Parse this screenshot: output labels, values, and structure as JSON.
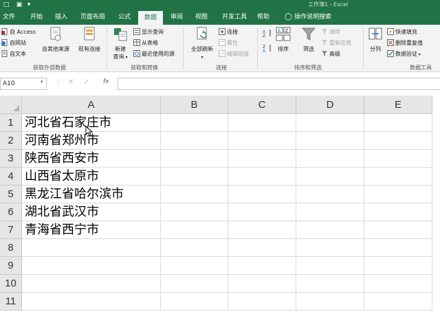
{
  "title_bar": {
    "doc_title": "工作簿1 - Excel"
  },
  "tabs": [
    {
      "label": "文件"
    },
    {
      "label": "开始"
    },
    {
      "label": "插入"
    },
    {
      "label": "页面布局"
    },
    {
      "label": "公式"
    },
    {
      "label": "数据"
    },
    {
      "label": "审阅"
    },
    {
      "label": "视图"
    },
    {
      "label": "开发工具"
    },
    {
      "label": "帮助"
    },
    {
      "label": "操作说明搜索"
    }
  ],
  "active_tab": "数据",
  "ribbon": {
    "get_external": {
      "from_access": "自 Access",
      "from_web": "自网站",
      "from_text": "自文本",
      "from_other": "自其他来源",
      "existing_conn": "现有连接",
      "label": "获取外部数据"
    },
    "get_transform": {
      "new_query_1": "新建",
      "new_query_2": "查询",
      "show_queries": "显示查询",
      "from_table": "从表格",
      "recent_sources": "最近使用的源",
      "label": "获取和转换"
    },
    "connections": {
      "refresh_all": "全部刷新",
      "connections": "连接",
      "properties": "属性",
      "edit_links": "编辑链接",
      "label": "连接"
    },
    "sort_filter": {
      "sort": "排序",
      "filter": "筛选",
      "clear": "清除",
      "reapply": "重新应用",
      "advanced": "高级",
      "label": "排序和筛选"
    },
    "data_tools": {
      "text_to_columns": "分列",
      "flash_fill": "快速填充",
      "remove_duplicates": "删除重复值",
      "data_validation": "数据验证",
      "label": "数据工具"
    }
  },
  "formula_bar": {
    "name_box": "A10",
    "fx": "fx",
    "formula": ""
  },
  "columns": [
    "A",
    "B",
    "C",
    "D",
    "E"
  ],
  "rows": [
    "1",
    "2",
    "3",
    "4",
    "5",
    "6",
    "7",
    "8",
    "9",
    "10",
    "11"
  ],
  "cells_a": [
    "河北省石家庄市",
    "河南省郑州市",
    "陕西省西安市",
    "山西省太原市",
    "黑龙江省哈尔滨市",
    "湖北省武汉市",
    "青海省西宁市",
    "",
    "",
    "",
    ""
  ],
  "colors": {
    "accent": "#217346",
    "ribbon_bg": "#f3f3f3",
    "header_bg": "#e6e6e6"
  }
}
